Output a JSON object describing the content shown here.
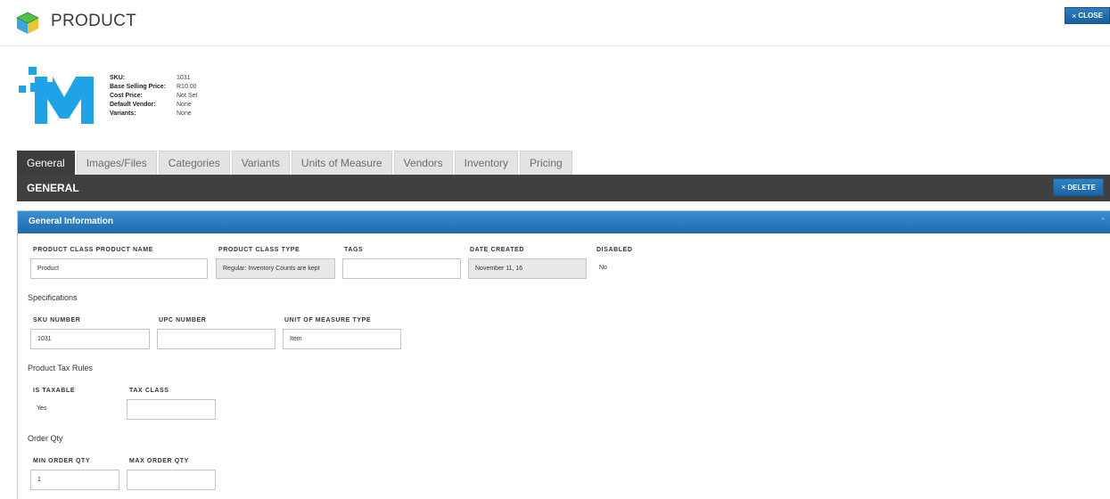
{
  "header": {
    "title": "PRODUCT",
    "close_label": "CLOSE",
    "icon": "cube-icon"
  },
  "summary": {
    "rows": [
      {
        "key": "SKU:",
        "value": "1031"
      },
      {
        "key": "Base Selling Price:",
        "value": "R10.00"
      },
      {
        "key": "Cost Price:",
        "value": "Not Set"
      },
      {
        "key": "Default Vendor:",
        "value": "None"
      },
      {
        "key": "Variants:",
        "value": "None"
      }
    ]
  },
  "tabs": [
    {
      "label": "General",
      "active": true
    },
    {
      "label": "Images/Files"
    },
    {
      "label": "Categories"
    },
    {
      "label": "Variants"
    },
    {
      "label": "Units of Measure"
    },
    {
      "label": "Vendors"
    },
    {
      "label": "Inventory"
    },
    {
      "label": "Pricing"
    }
  ],
  "section": {
    "title": "GENERAL",
    "delete_label": "DELETE"
  },
  "panel": {
    "title": "General Information",
    "fields": {
      "product_name": {
        "label": "PRODUCT CLASS PRODUCT NAME",
        "value": "Product"
      },
      "class_type": {
        "label": "PRODUCT CLASS TYPE",
        "value": "Regular: Inventory Counts are kept"
      },
      "tags": {
        "label": "TAGS",
        "value": ""
      },
      "date_created": {
        "label": "DATE CREATED",
        "value": "November 11, 16"
      },
      "disabled": {
        "label": "DISABLED",
        "value": "No"
      }
    },
    "specifications": {
      "title": "Specifications",
      "sku": {
        "label": "SKU NUMBER",
        "value": "1031"
      },
      "upc": {
        "label": "UPC NUMBER",
        "value": ""
      },
      "uom_type": {
        "label": "UNIT OF MEASURE TYPE",
        "value": "Item"
      }
    },
    "tax": {
      "title": "Product Tax Rules",
      "taxable": {
        "label": "IS TAXABLE",
        "value": "Yes"
      },
      "tax_class": {
        "label": "TAX CLASS",
        "value": ""
      }
    },
    "order_qty": {
      "title": "Order Qty",
      "min": {
        "label": "MIN ORDER QTY",
        "value": "1"
      },
      "max": {
        "label": "MAX ORDER QTY",
        "value": ""
      }
    }
  }
}
